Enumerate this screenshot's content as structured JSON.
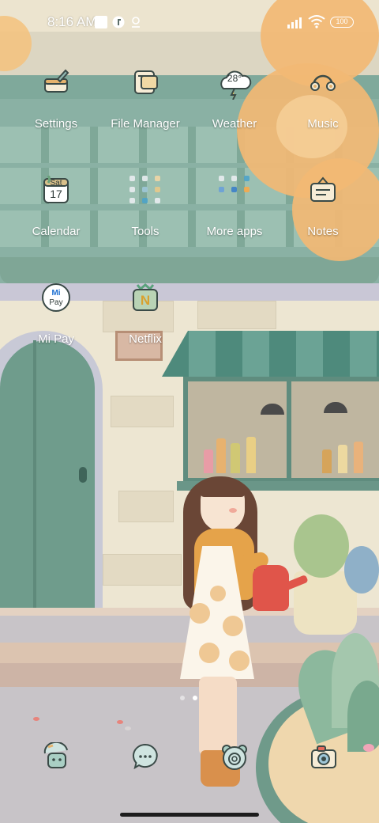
{
  "status_bar": {
    "time": "8:16 AM",
    "battery": "100",
    "icons": [
      "app-square-icon",
      "notification-f-icon",
      "location-icon",
      "signal-icon",
      "wifi-icon",
      "battery-icon"
    ]
  },
  "apps_row1": [
    {
      "label": "Settings",
      "icon": "settings-toolbox-icon"
    },
    {
      "label": "File Manager",
      "icon": "file-manager-icon"
    },
    {
      "label": "Weather",
      "icon": "weather-cloud-icon",
      "temperature": "28°"
    },
    {
      "label": "Music",
      "icon": "headphones-icon"
    }
  ],
  "apps_row2": [
    {
      "label": "Calendar",
      "icon": "calendar-icon",
      "day": "Sat",
      "date": "17"
    },
    {
      "label": "Tools",
      "icon": "tools-folder-icon"
    },
    {
      "label": "More apps",
      "icon": "more-apps-folder-icon"
    },
    {
      "label": "Notes",
      "icon": "notes-sign-icon"
    }
  ],
  "apps_row3": [
    {
      "label": "Mi Pay",
      "icon": "mi-pay-icon",
      "badge_top": "Mi",
      "badge_bottom": "Pay"
    },
    {
      "label": "Netflix",
      "icon": "netflix-n-icon",
      "letter": "N"
    }
  ],
  "page_indicator": {
    "pages": 2,
    "current": 2
  },
  "dock": [
    {
      "icon": "phone-robot-icon"
    },
    {
      "icon": "messages-bubble-icon"
    },
    {
      "icon": "bear-browser-icon"
    },
    {
      "icon": "camera-icon"
    }
  ],
  "colors": {
    "label": "#ffffff",
    "icon_outline": "#3a4a47",
    "icon_fill": "#f6ecd6"
  }
}
